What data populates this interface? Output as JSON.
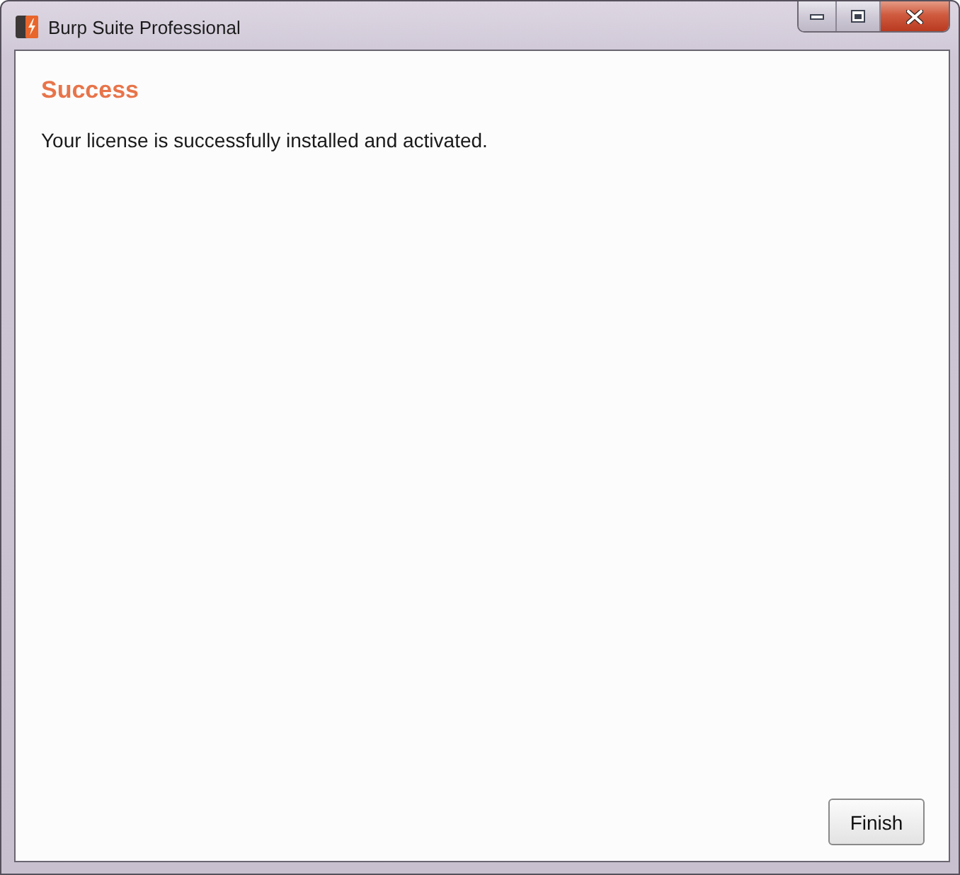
{
  "window": {
    "title": "Burp Suite Professional"
  },
  "heading": "Success",
  "message": "Your license is successfully installed and activated.",
  "buttons": [
    "Finish"
  ]
}
